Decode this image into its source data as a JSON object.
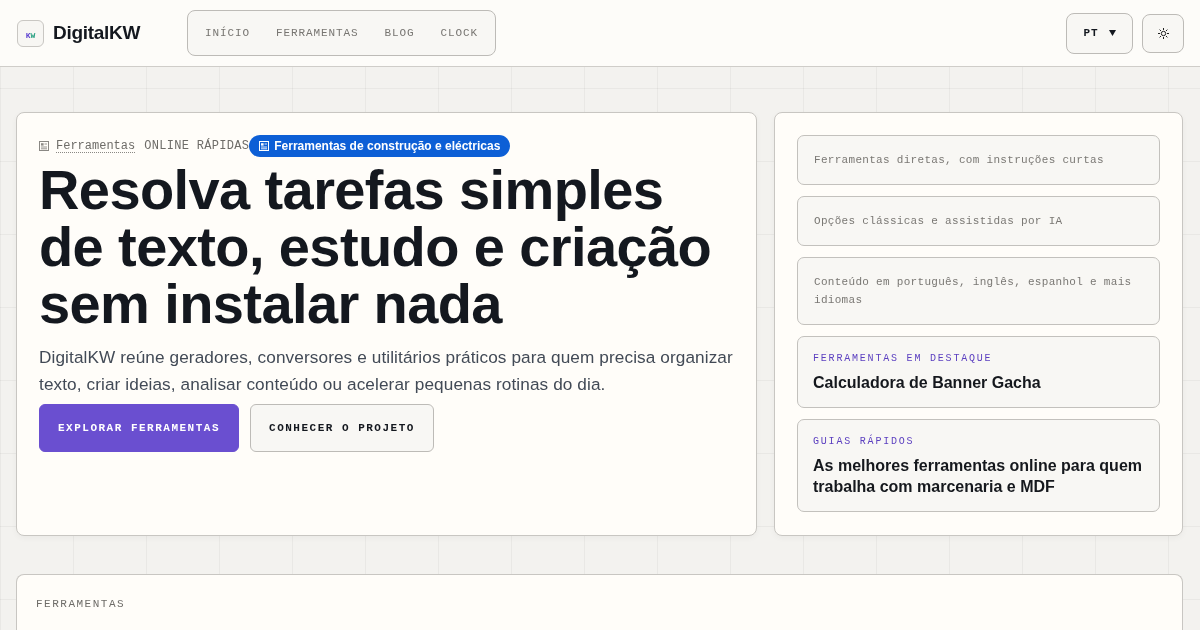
{
  "header": {
    "logo": {
      "mark": "KW",
      "name": "DigitalKW"
    },
    "nav": [
      {
        "label": "INÍCIO",
        "selected": false
      },
      {
        "label": "FERRAMENTAS",
        "selected": false
      },
      {
        "label": "BLOG",
        "selected": false
      },
      {
        "label": "CLOCK",
        "selected": false
      }
    ],
    "language": {
      "label": "PT"
    }
  },
  "hero": {
    "eyebrow": {
      "link": "Ferramentas",
      "text": "ONLINE RÁPIDAS"
    },
    "badge": "Ferramentas de construção e eléctricas",
    "title": "Resolva tarefas simples de texto, estudo e criação sem instalar nada",
    "description": "DigitalKW reúne geradores, conversores e utilitários práticos para quem precisa organizar texto, criar ideias, analisar conteúdo ou acelerar pequenas rotinas do dia.",
    "buttons": [
      {
        "label": "EXPLORAR FERRAMENTAS",
        "kind": "primary"
      },
      {
        "label": "CONHECER O PROJETO",
        "kind": "secondary"
      }
    ]
  },
  "highlights": [
    {
      "kind": "note",
      "text": "Ferramentas diretas, com instruções curtas"
    },
    {
      "kind": "note",
      "text": "Opções clássicas e assistidas por IA"
    },
    {
      "kind": "note",
      "text": "Conteúdo em português, inglês, espanhol e mais idiomas"
    },
    {
      "kind": "feature",
      "label": "FERRAMENTAS EM DESTAQUE",
      "title": "Calculadora de Banner Gacha"
    },
    {
      "kind": "feature",
      "label": "GUIAS RÁPIDOS",
      "title": "As melhores ferramentas online para quem trabalha com marcenaria e MDF"
    }
  ],
  "section": {
    "label": "FERRAMENTAS"
  }
}
